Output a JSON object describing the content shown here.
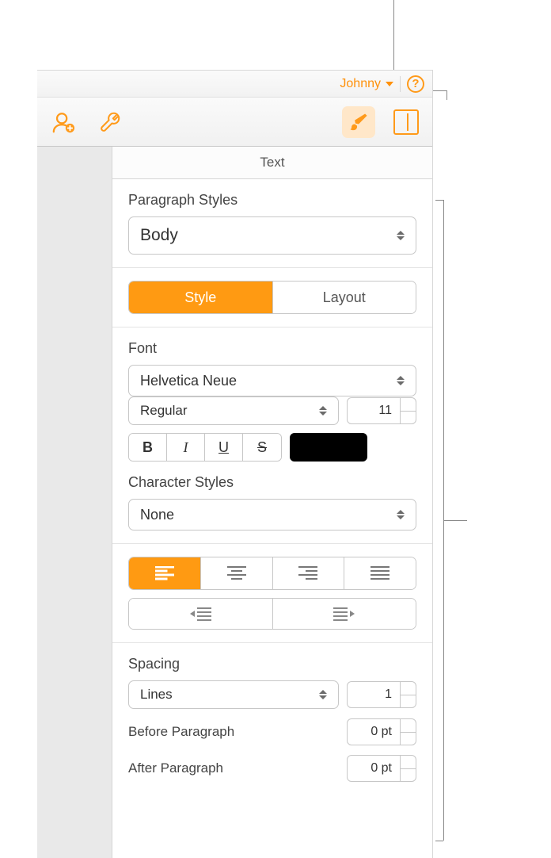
{
  "colors": {
    "accent": "#ff9a12",
    "text_color_well": "#000000"
  },
  "titlebar": {
    "user_name": "Johnny",
    "help_label": "?"
  },
  "toolbar": {
    "collaborate_icon": "collaborate-icon",
    "tools_icon": "wrench-icon",
    "format_icon": "brush-icon",
    "document_icon": "document-icon"
  },
  "inspector": {
    "header": "Text",
    "paragraph_styles": {
      "label": "Paragraph Styles",
      "value": "Body"
    },
    "tabs": {
      "style": "Style",
      "layout": "Layout",
      "active": "style"
    },
    "font": {
      "label": "Font",
      "family": "Helvetica Neue",
      "typeface": "Regular",
      "size": "11",
      "bold": "B",
      "italic": "I",
      "underline": "U",
      "strike": "S"
    },
    "character_styles": {
      "label": "Character Styles",
      "value": "None"
    },
    "alignment": {
      "active": "left"
    },
    "spacing": {
      "label": "Spacing",
      "mode": "Lines",
      "value": "1",
      "before_label": "Before Paragraph",
      "before_value": "0 pt",
      "after_label": "After Paragraph",
      "after_value": "0 pt"
    }
  }
}
